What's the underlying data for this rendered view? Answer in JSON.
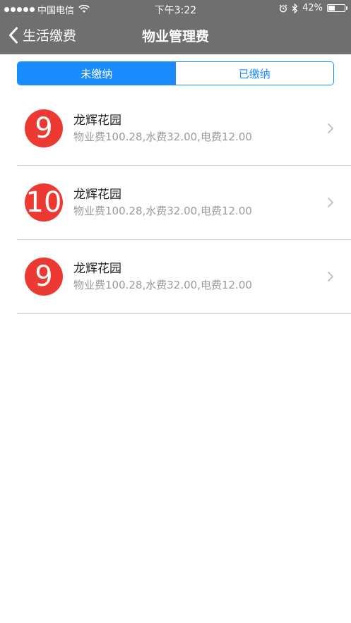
{
  "status_bar": {
    "carrier": "中国电信",
    "time": "下午3:22",
    "battery_percent": "42%",
    "battery_level": 0.42,
    "signal_icon": "signal-dots-icon",
    "wifi_icon": "wifi-icon",
    "alarm_icon": "alarm-icon",
    "bluetooth_icon": "bluetooth-icon"
  },
  "navbar": {
    "back_label": "生活缴费",
    "title": "物业管理费"
  },
  "tabs": [
    {
      "label": "未缴纳",
      "active": true
    },
    {
      "label": "已缴纳",
      "active": false
    }
  ],
  "bills": [
    {
      "badge": "9",
      "title": "龙辉花园",
      "detail": "物业费100.28,水费32.00,电费12.00"
    },
    {
      "badge": "10",
      "title": "龙辉花园",
      "detail": "物业费100.28,水费32.00,电费12.00"
    },
    {
      "badge": "9",
      "title": "龙辉花园",
      "detail": "物业费100.28,水费32.00,电费12.00"
    }
  ],
  "colors": {
    "header_bg": "#6f6f6f",
    "accent": "#1a8cff",
    "badge": "#ec3a33"
  }
}
